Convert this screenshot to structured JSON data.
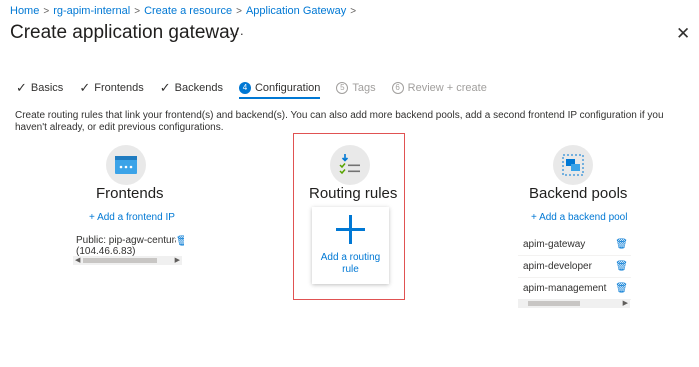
{
  "breadcrumb": [
    "Home",
    "rg-apim-internal",
    "Create a resource",
    "Application Gateway"
  ],
  "page": {
    "title": "Create application gateway",
    "more": "···",
    "close": "✕"
  },
  "tabs": [
    {
      "label": "Basics",
      "state": "done"
    },
    {
      "label": "Frontends",
      "state": "done"
    },
    {
      "label": "Backends",
      "state": "done"
    },
    {
      "label": "Configuration",
      "state": "active",
      "number": "4"
    },
    {
      "label": "Tags",
      "state": "disabled",
      "number": "5"
    },
    {
      "label": "Review + create",
      "state": "disabled",
      "number": "6"
    }
  ],
  "description": "Create routing rules that link your frontend(s) and backend(s). You can also add more backend pools, add a second frontend IP configuration if you haven't already, or edit previous configurations.",
  "frontends": {
    "title": "Frontends",
    "add_label": "+ Add a frontend IP",
    "items": [
      {
        "line1": "Public: pip-agw-centura",
        "line2": "(104.46.6.83)"
      }
    ]
  },
  "routing": {
    "title": "Routing rules",
    "add_label": "Add a routing rule"
  },
  "backends": {
    "title": "Backend pools",
    "add_label": "+ Add a backend pool",
    "items": [
      "apim-gateway",
      "apim-developer",
      "apim-management"
    ]
  },
  "colors": {
    "accent": "#0078d4",
    "highlight": "#e05252"
  }
}
